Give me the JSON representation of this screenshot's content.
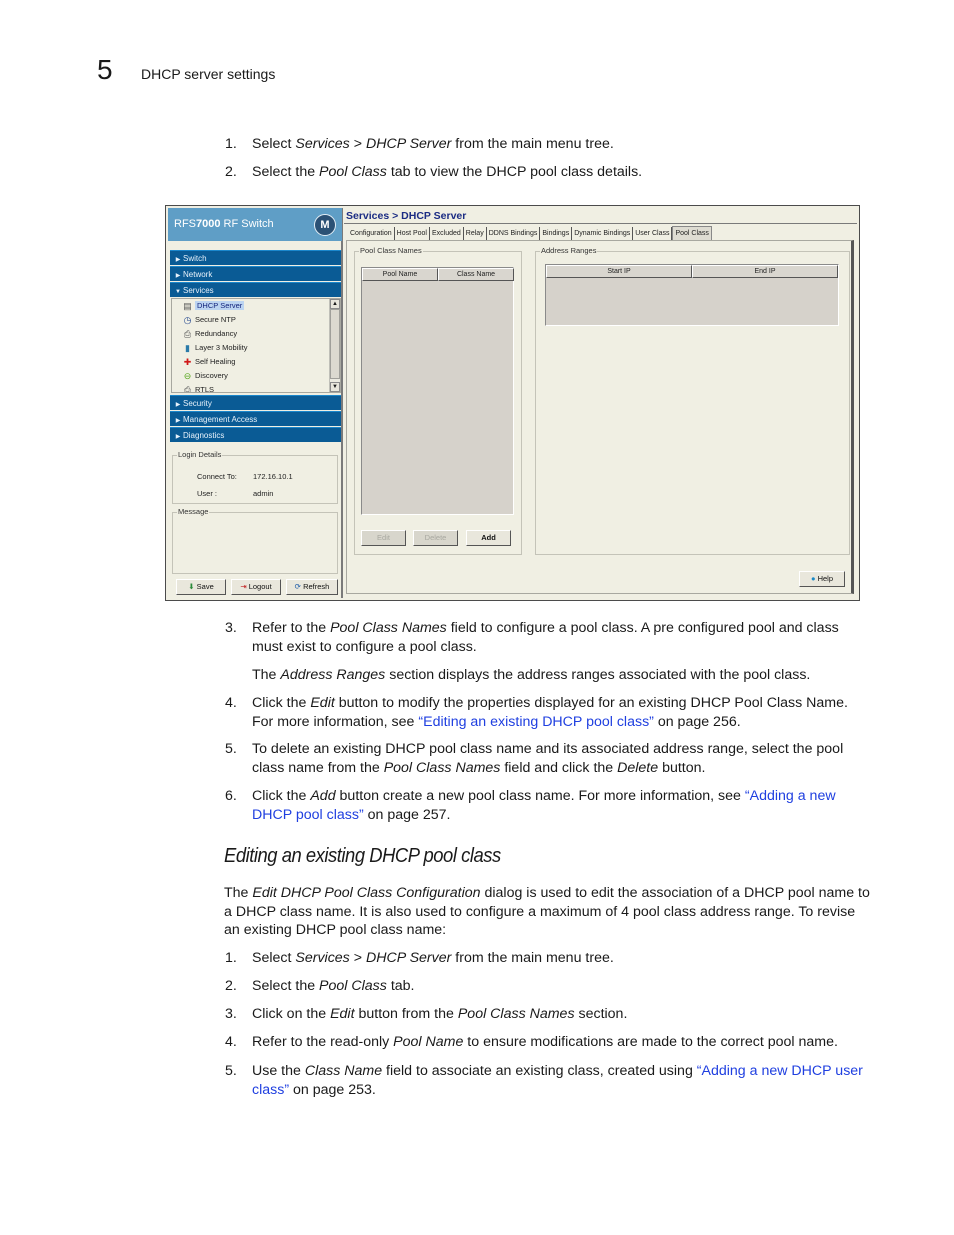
{
  "page_header": {
    "chapter_number": "5",
    "chapter_title": "DHCP server settings"
  },
  "intro_steps": [
    {
      "num": "1.",
      "parts": [
        "Select ",
        {
          "i": "Services"
        },
        " > ",
        {
          "i": "DHCP Server"
        },
        " from the main menu tree."
      ]
    },
    {
      "num": "2.",
      "parts": [
        "Select the ",
        {
          "i": "Pool Class"
        },
        " tab to view the DHCP pool class details."
      ]
    }
  ],
  "screenshot": {
    "brand": {
      "prefix": "RFS",
      "model": "7000",
      "suffix": " RF Switch",
      "logo_glyph": "M"
    },
    "nav_sections_top": [
      {
        "label": "Switch",
        "icon": "triangle-right-icon",
        "glyph": "▶"
      },
      {
        "label": "Network",
        "icon": "triangle-right-icon",
        "glyph": "▶"
      },
      {
        "label": "Services",
        "icon": "triangle-down-icon",
        "glyph": "▼"
      }
    ],
    "tree_items": [
      {
        "label": "DHCP Server",
        "icon": "dhcp-server-icon",
        "glyph": "▤",
        "selected": true
      },
      {
        "label": "Secure NTP",
        "icon": "clock-icon",
        "glyph": "◷"
      },
      {
        "label": "Redundancy",
        "icon": "printer-icon",
        "glyph": "⎙"
      },
      {
        "label": "Layer 3 Mobility",
        "icon": "mobility-icon",
        "glyph": "▮"
      },
      {
        "label": "Self Healing",
        "icon": "self-healing-icon",
        "glyph": "✚"
      },
      {
        "label": "Discovery",
        "icon": "discovery-icon",
        "glyph": "⊖"
      },
      {
        "label": "RTLS",
        "icon": "rtls-icon",
        "glyph": "⎙"
      }
    ],
    "nav_sections_bottom": [
      {
        "label": "Security",
        "glyph": "▶"
      },
      {
        "label": "Management Access",
        "glyph": "▶"
      },
      {
        "label": "Diagnostics",
        "glyph": "▶"
      }
    ],
    "login_details": {
      "title": "Login Details",
      "connect_to_label": "Connect To:",
      "connect_to_value": "172.16.10.1",
      "user_label": "User :",
      "user_value": "admin"
    },
    "message": {
      "title": "Message",
      "text": ""
    },
    "footer_buttons": {
      "save": "Save",
      "logout": "Logout",
      "refresh": "Refresh"
    },
    "breadcrumb": "Services > DHCP Server",
    "tabs": [
      "Configuration",
      "Host Pool",
      "Excluded",
      "Relay",
      "DDNS Bindings",
      "Bindings",
      "Dynamic Bindings",
      "User Class",
      "Pool Class"
    ],
    "active_tab": "Pool Class",
    "pool_class_names": {
      "title": "Pool Class Names",
      "columns": [
        "Pool Name",
        "Class Name"
      ],
      "rows": [],
      "buttons": {
        "edit": "Edit",
        "delete": "Delete",
        "add": "Add"
      }
    },
    "address_ranges": {
      "title": "Address Ranges",
      "columns": [
        "Start IP",
        "End IP"
      ],
      "rows": []
    },
    "help_button": "Help"
  },
  "steps_after": [
    {
      "num": "3.",
      "parts": [
        "Refer to the ",
        {
          "i": "Pool Class Names"
        },
        " field to configure a pool class. A pre configured pool and class must exist to configure a pool class."
      ]
    },
    {
      "para": true,
      "parts": [
        "The ",
        {
          "i": "Address Ranges"
        },
        " section displays the address ranges associated with the pool class."
      ]
    },
    {
      "num": "4.",
      "parts": [
        "Click the ",
        {
          "i": "Edit"
        },
        " button to modify the properties displayed for an existing DHCP Pool Class Name. For more information, see ",
        {
          "a": "“Editing an existing DHCP pool class”"
        },
        " on page 256."
      ]
    },
    {
      "num": "5.",
      "parts": [
        "To delete an existing DHCP pool class name and its associated address range, select the pool class name from the ",
        {
          "i": "Pool Class Names"
        },
        " field and click the ",
        {
          "i": "Delete"
        },
        " button."
      ]
    },
    {
      "num": "6.",
      "parts": [
        "Click the ",
        {
          "i": "Add"
        },
        " button create a new pool class name. For more information, see ",
        {
          "a": "“Adding a new DHCP pool class”"
        },
        " on page 257."
      ]
    }
  ],
  "section": {
    "heading": "Editing an existing DHCP pool class",
    "intro_parts": [
      "The ",
      {
        "i": "Edit DHCP Pool Class Configuration"
      },
      " dialog is used to edit the association of a DHCP pool name to a DHCP class name. It is also used to configure a maximum of 4 pool class address range. To revise an existing DHCP pool class name:"
    ],
    "steps": [
      {
        "num": "1.",
        "parts": [
          "Select ",
          {
            "i": "Services"
          },
          " > ",
          {
            "i": "DHCP Server"
          },
          " from the main menu tree."
        ]
      },
      {
        "num": "2.",
        "parts": [
          "Select the ",
          {
            "i": "Pool Class"
          },
          " tab."
        ]
      },
      {
        "num": "3.",
        "parts": [
          "Click on the ",
          {
            "i": "Edit"
          },
          " button from the ",
          {
            "i": "Pool Class Names"
          },
          " section."
        ]
      },
      {
        "num": "4.",
        "parts": [
          "Refer to the read-only ",
          {
            "i": "Pool Name"
          },
          " to ensure modifications are made to the correct pool name."
        ]
      },
      {
        "num": "5.",
        "parts": [
          "Use the ",
          {
            "i": "Class Name"
          },
          " field to associate an existing class, created using ",
          {
            "a": "“Adding a new DHCP user class”"
          },
          " on page 253."
        ]
      }
    ]
  },
  "colors": {
    "link": "#1f3fe0",
    "nav_bar": "#0a5b95",
    "brand_bar": "#5f9ec6",
    "breadcrumb": "#1b2c83"
  }
}
